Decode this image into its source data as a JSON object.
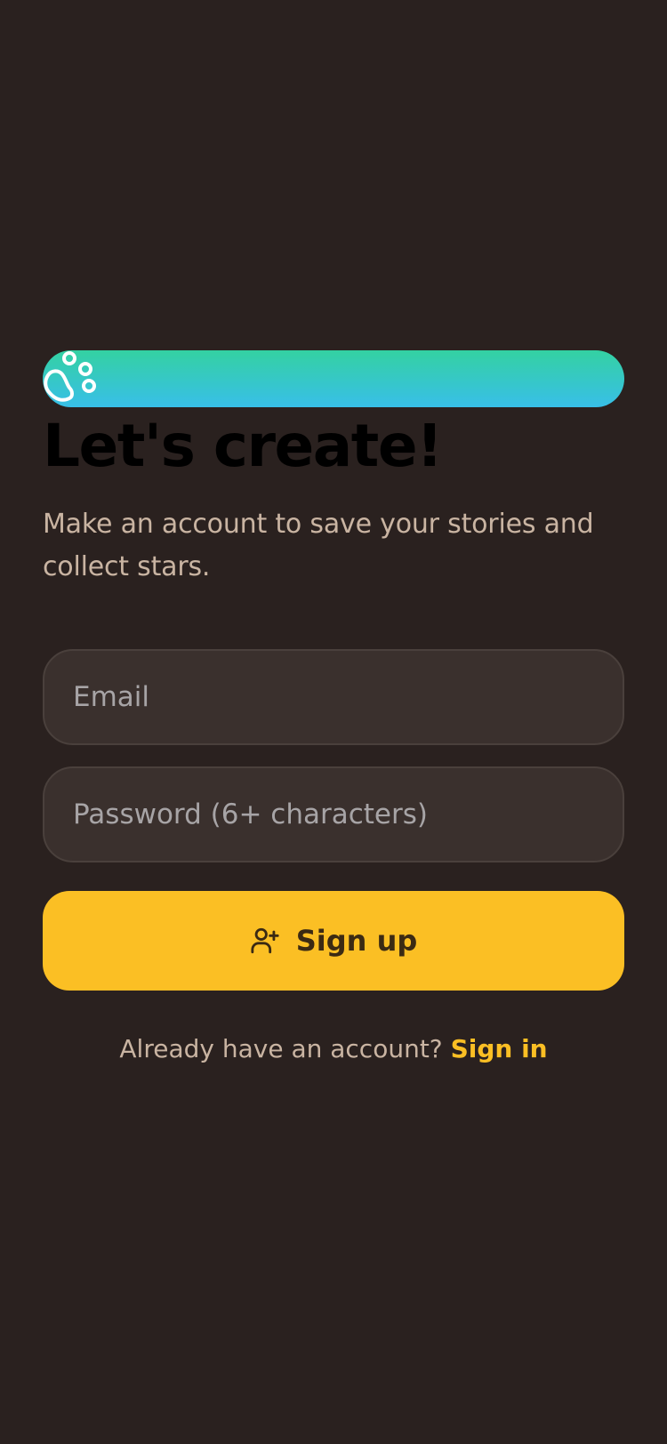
{
  "colors": {
    "background": "#2a211f",
    "brand_gradient_top": "#34d1a2",
    "brand_gradient_bottom": "#38bfe8",
    "headline": "#000000",
    "subtitle": "#c9b4a2",
    "field_background": "#3a302d",
    "placeholder": "#a7a4a6",
    "accent": "#fbbf24",
    "button_text": "#3b2a13"
  },
  "brand": {
    "icon": "paw-icon"
  },
  "header": {
    "title": "Let's create!",
    "subtitle": "Make an account to save your stories and collect stars."
  },
  "form": {
    "email": {
      "placeholder": "Email",
      "value": ""
    },
    "password": {
      "placeholder": "Password (6+ characters)",
      "value": ""
    },
    "submit": {
      "label": "Sign up",
      "icon": "user-plus-icon"
    }
  },
  "footer": {
    "prompt": "Already have an account?",
    "link_label": "Sign in"
  }
}
